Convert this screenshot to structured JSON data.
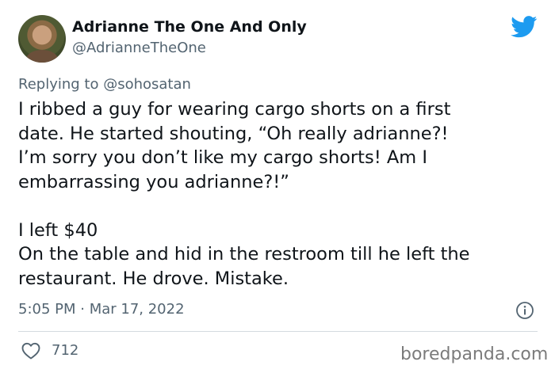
{
  "author": {
    "display_name": "Adrianne The One And Only",
    "handle": "@AdrianneTheOne",
    "avatar_icon": "profile-photo"
  },
  "reply": {
    "prefix": "Replying to ",
    "mention": "@sohosatan"
  },
  "tweet": {
    "text": "I ribbed a guy for wearing cargo shorts on a first\ndate. He started shouting, “Oh really adrianne?!\nI’m sorry you don’t like my cargo shorts! Am I\nembarrassing you adrianne?!”\n\nI left $40\nOn the table and hid in the restroom till he left the\nrestaurant. He drove. Mistake.",
    "timestamp": "5:05 PM · Mar 17, 2022"
  },
  "actions": {
    "like_count": "712",
    "like_icon": "heart-icon",
    "info_icon": "info-icon"
  },
  "brand": {
    "logo_icon": "twitter-bird-icon",
    "logo_color": "#1d9bf0",
    "watermark": "boredpanda.com"
  }
}
